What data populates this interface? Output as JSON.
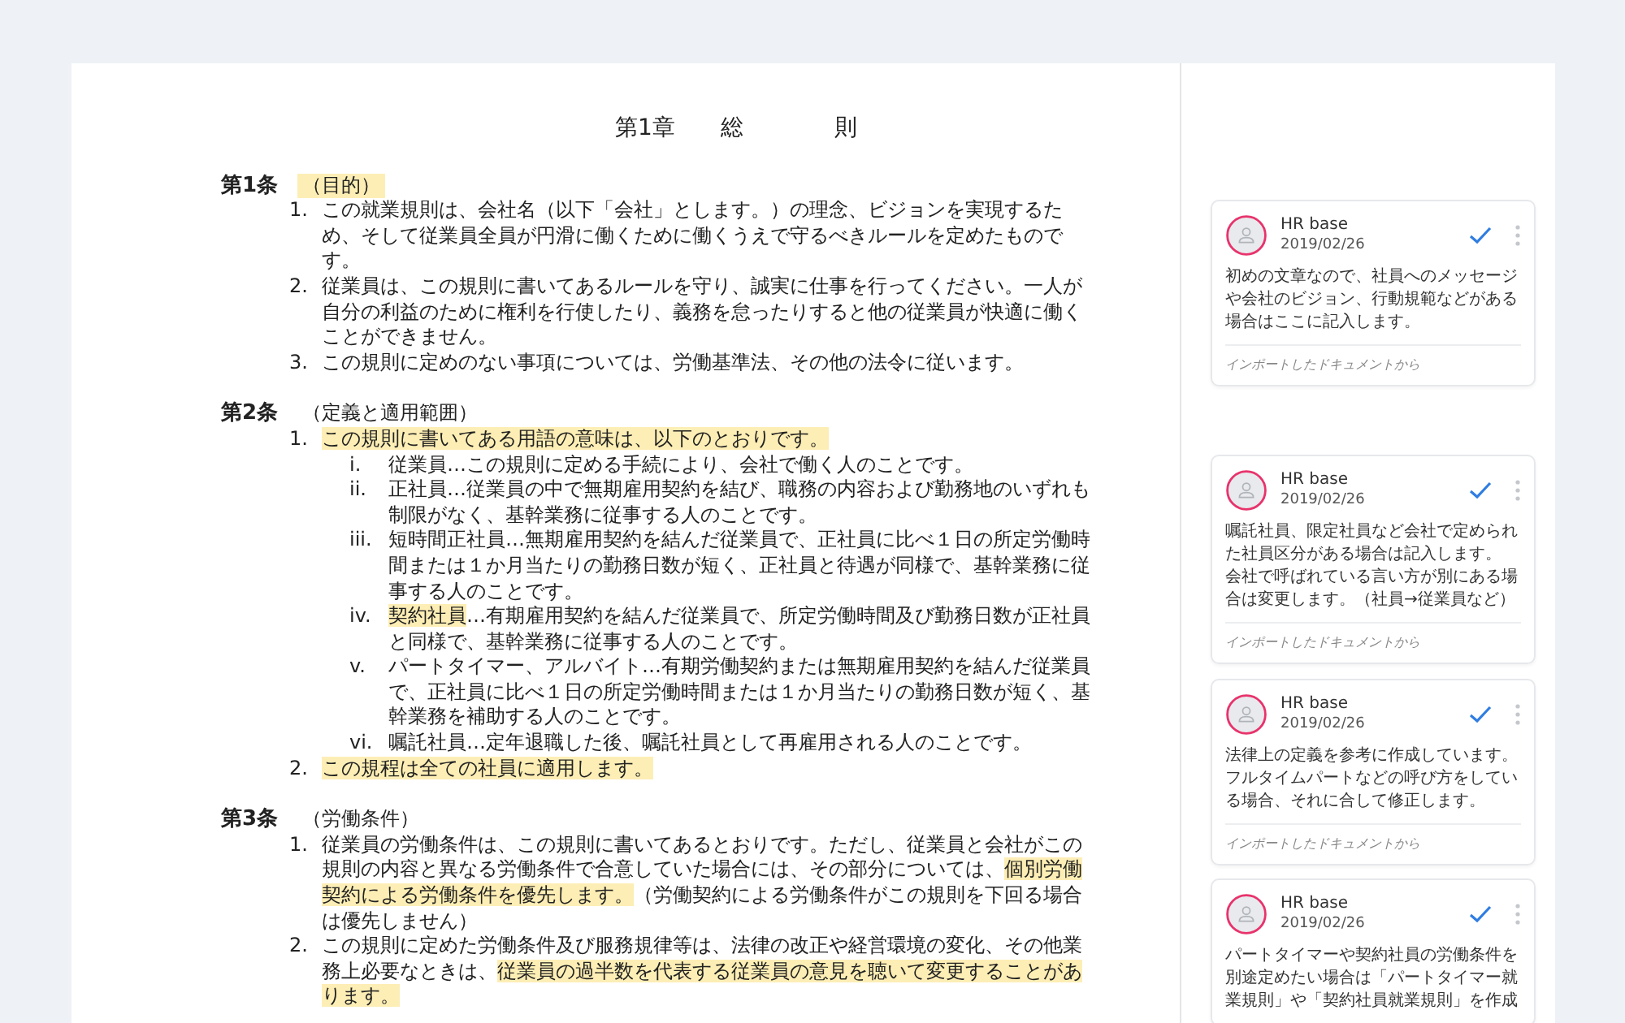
{
  "document": {
    "chapter_title": {
      "label": "第1章",
      "words": [
        "総",
        "則"
      ]
    },
    "articles": [
      {
        "number": "第1条",
        "heading": "（目的）",
        "heading_highlighted": true,
        "items": [
          {
            "number": "1.",
            "segments": [
              {
                "text": "この就業規則は、会社名（以下「会社」とします。）の理念、ビジョンを実現するため、そして従業員全員が円滑に働くために働くうえで守るべきルールを定めたものです。",
                "highlighted": false
              }
            ]
          },
          {
            "number": "2.",
            "segments": [
              {
                "text": "従業員は、この規則に書いてあるルールを守り、誠実に仕事を行ってください。一人が自分の利益のために権利を行使したり、義務を怠ったりすると他の従業員が快適に働くことができません。",
                "highlighted": false
              }
            ]
          },
          {
            "number": "3.",
            "segments": [
              {
                "text": "この規則に定めのない事項については、労働基準法、その他の法令に従います。",
                "highlighted": false
              }
            ]
          }
        ]
      },
      {
        "number": "第2条",
        "heading": "（定義と適用範囲）",
        "heading_highlighted": false,
        "items": [
          {
            "number": "1.",
            "segments": [
              {
                "text": "この規則に書いてある用語の意味は、以下のとおりです。",
                "highlighted": true
              }
            ],
            "subitems": [
              {
                "number": "i.",
                "segments": [
                  {
                    "text": "従業員…この規則に定める手続により、会社で働く人のことです。",
                    "highlighted": false
                  }
                ]
              },
              {
                "number": "ii.",
                "segments": [
                  {
                    "text": "正社員…従業員の中で無期雇用契約を結び、職務の内容および勤務地のいずれも制限がなく、基幹業務に従事する人のことです。",
                    "highlighted": false
                  }
                ]
              },
              {
                "number": "iii.",
                "segments": [
                  {
                    "text": "短時間正社員…無期雇用契約を結んだ従業員で、正社員に比べ１日の所定労働時間または１か月当たりの勤務日数が短く、正社員と待遇が同様で、基幹業務に従事する人のことです。",
                    "highlighted": false
                  }
                ]
              },
              {
                "number": "iv.",
                "segments": [
                  {
                    "text": "契約社員",
                    "highlighted": true
                  },
                  {
                    "text": "…有期雇用契約を結んだ従業員で、所定労働時間及び勤務日数が正社員と同様で、基幹業務に従事する人のことです。",
                    "highlighted": false
                  }
                ]
              },
              {
                "number": "v.",
                "segments": [
                  {
                    "text": "パートタイマー、アルバイト…有期労働契約または無期雇用契約を結んだ従業員で、正社員に比べ１日の所定労働時間または１か月当たりの勤務日数が短く、基幹業務を補助する人のことです。",
                    "highlighted": false
                  }
                ]
              },
              {
                "number": "vi.",
                "segments": [
                  {
                    "text": "嘱託社員…定年退職した後、嘱託社員として再雇用される人のことです。",
                    "highlighted": false
                  }
                ]
              }
            ]
          },
          {
            "number": "2.",
            "segments": [
              {
                "text": "この規程は全ての社員に適用します。",
                "highlighted": true
              }
            ]
          }
        ]
      },
      {
        "number": "第3条",
        "heading": "（労働条件）",
        "heading_highlighted": false,
        "items": [
          {
            "number": "1.",
            "segments": [
              {
                "text": "従業員の労働条件は、この規則に書いてあるとおりです。ただし、従業員と会社がこの規則の内容と異なる労働条件で合意していた場合には、その部分については、",
                "highlighted": false
              },
              {
                "text": "個別労働契約による労働条件を優先します。",
                "highlighted": true
              },
              {
                "text": "（労働契約による労働条件がこの規則を下回る場合は優先しません）",
                "highlighted": false
              }
            ]
          },
          {
            "number": "2.",
            "segments": [
              {
                "text": "この規則に定めた労働条件及び服務規律等は、法律の改正や経営環境の変化、その他業務上必要なときは、",
                "highlighted": false
              },
              {
                "text": "従業員の過半数を代表する従業員の意見を聴いて変更することがあります。",
                "highlighted": true
              }
            ]
          }
        ]
      }
    ]
  },
  "comments": [
    {
      "author": "HR base",
      "date": "2019/02/26",
      "resolved": true,
      "text": "初めの文章なので、社員へのメッセージや会社のビジョン、行動規範などがある場合はここに記入します。",
      "source": "インポートしたドキュメントから"
    },
    {
      "author": "HR base",
      "date": "2019/02/26",
      "resolved": true,
      "text": "嘱託社員、限定社員など会社で定められた社員区分がある場合は記入します。",
      "text_2": "会社で呼ばれている言い方が別にある場合は変更します。（社員→従業員など）",
      "source": "インポートしたドキュメントから"
    },
    {
      "author": "HR base",
      "date": "2019/02/26",
      "resolved": true,
      "text": "法律上の定義を参考に作成しています。フルタイムパートなどの呼び方をしている場合、それに合して修正します。",
      "source": "インポートしたドキュメントから"
    },
    {
      "author": "HR base",
      "date": "2019/02/26",
      "resolved": true,
      "text": "パートタイマーや契約社員の労働条件を別途定めたい場合は「パートタイマー就業規則」や「契約社員就業規則」を作成"
    }
  ]
}
